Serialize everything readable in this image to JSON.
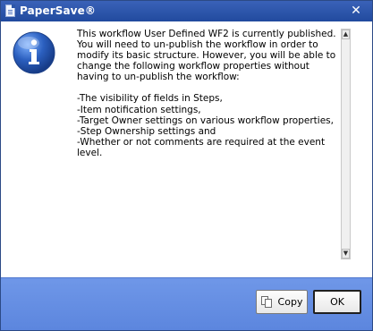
{
  "window": {
    "title": "PaperSave®",
    "close_glyph": "✕"
  },
  "message": {
    "intro": "This workflow User Defined WF2 is currently published.\nYou will need to un-publish the workflow in order to\nmodify its basic structure.  However, you will be able to\nchange the following workflow properties without\nhaving to un-publish the workflow:",
    "items": [
      "-The visibility of fields in Steps,",
      "-Item notification settings,",
      "-Target Owner settings on various workflow properties,",
      "-Step Ownership settings and",
      "-Whether or not comments are required at the event\nlevel."
    ]
  },
  "buttons": {
    "copy": "Copy",
    "ok": "OK"
  },
  "icons": {
    "dialog": "information-icon",
    "copy": "copy-icon",
    "scroll_up": "▲",
    "scroll_down": "▼"
  },
  "colors": {
    "titlebar": "#2a53a8",
    "footer": "#6a91e5",
    "info_icon": "#2b5fbf"
  }
}
